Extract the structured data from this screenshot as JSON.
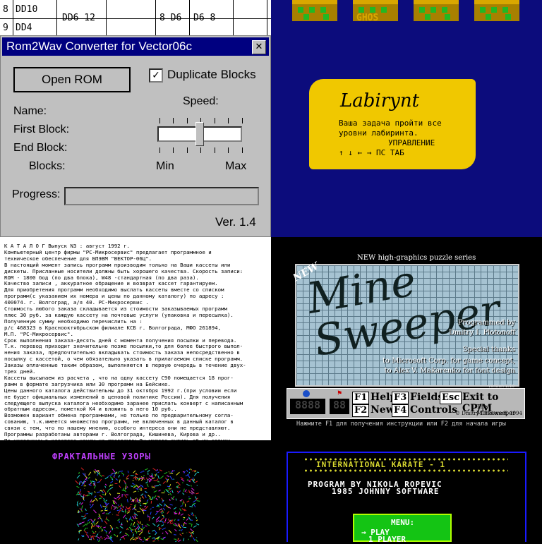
{
  "table": {
    "rows": [
      {
        "num": "8",
        "name": "DD10",
        "a": "DD6  12",
        "b": "8  D6",
        "c": "D6   8"
      },
      {
        "num": "9",
        "name": "DD4"
      }
    ]
  },
  "window": {
    "title": "Rom2Wav Converter for Vector06c",
    "close_glyph": "✕",
    "open_rom": "Open ROM",
    "duplicate_blocks": "Duplicate Blocks",
    "duplicate_checked": true,
    "check_glyph": "✓",
    "speed": "Speed:",
    "name": "Name:",
    "first_block": "First Block:",
    "end_block": "End Block:",
    "blocks": "Blocks:",
    "min": "Min",
    "max": "Max",
    "progress": "Progress:",
    "version": "Ver. 1.4"
  },
  "game": {
    "ghos": "GHOS",
    "scroll_title": "Labirynt",
    "scroll_lines": [
      "Ваша задача пройти все",
      "уровни лабиринта.",
      "УПРАВЛЕНИЕ",
      "↑  ↓  ←  →  ПС  ТАБ"
    ]
  },
  "catalog": {
    "lines": [
      "К А Т А Л О Г                                    Выпуск N3 : август 1992 г.",
      "     Компьютерный центр фирмы  \"PC-Микросервис\"  предлагает программное и",
      "техническое обеспечение для БПЭВМ \"ВЕКТОР-06Ц\".",
      "   В настоящий момент запись программ производим только на Ваши кассеты или",
      "дискеты. Присланные носители должны быть хорошего качества. Скорость записи:",
      " ROM - 1800 бод (по два блока), W48 -стандартная (по два раза).",
      "Качество   записи , аккуратное обращение  и возврат   кассет  гарантируем.",
      "   Для приобретения программ необходимо выслать  кассеты  вместе со списком",
      "программ(с указанием их номера и цены по данному каталогу) по адресу :",
      "      400074. г. Волгоград, а/я 40. PC-Микросервис .",
      "  Стоимость любого заказа складывается  из стоимости заказываемых  программ",
      "плюс  30 руб. за каждую кассету  на  почтовые услуги (упаковка и пересылка).",
      "Полученную сумму необходимо перечислить на :",
      "    р/с 468323 в Краснооктябрьском филиале КСБ г. Волгограда, МФО 261894,",
      "          М.П. \"PC-Микросервис\".",
      "   Срок выполнения заказа-десять дней с момента получения посылки и перевода.",
      "   Т.к. перевод приходит значительно позже посылки,то для более быстрого выпол-",
      "нения заказа, предпочтительно вкладывать стоимость заказа  непосредственно  в",
      "посылку с кассетой, о чем обязательно указать в прилагаемом списке программ.",
      "Заказы оплаченные таким образом, выполняются в первую очередь в течение двух-",
      "трех дней.",
      "   Кассеты  высылаем из расчета , что на одну кассету С90 помещается 18 прог-",
      "рамм в формате загрузчика или 30 программ на Бейсике.",
      "   Цены данного каталога действительны до 31 октября 1992 г.(при условии если",
      "не  будет официальных изменений  в  ценовой политике России). Для  получения",
      "следующего выпуска каталога необходимо заранее прислать конверт с написанным",
      "обратным адресом, пометкой К4 и вложить в него 10 руб..",
      "   Возможен вариант обмена программами, но только по предварительному согла-",
      "сованию, т.к.имеется множество программ, не включенных в данный каталог  в",
      "  связи с тем, что по нашему мнению, особого интереса они не представляют.",
      "   Программы разработаны авторами г. Волгограда, Кишинева, Кирова и др..",
      "   По указанным в каталоге ценам на программы  Вы можете судить об их совмен-"
    ]
  },
  "mine": {
    "header": "NEW high-graphics puzzle series",
    "badge": "NEW",
    "title1": "Mine",
    "title2": "Sweeper",
    "programmed": "Programmed by",
    "author": "Dmitry I. Plotonoff",
    "thanks": "Special thanks",
    "thanks1": "to Microsoft Corp. for game concept,",
    "thanks2": "to Alex V. Makarenko for font design",
    "version": "version 1.10",
    "lcd1": "8888",
    "lcd2": "88",
    "k_f1": "F1",
    "l_help": "Help",
    "k_f3": "F3",
    "l_fields": "Fields",
    "k_esc": "Esc",
    "l_exit": "Exit to CP/M",
    "k_f2": "F2",
    "l_new": "New",
    "k_f4": "F4",
    "l_controls": "Controls",
    "small_title": "The Minesweeper",
    "copyright": "© Dmitry I.Plotonoff, 1994",
    "footer": "Нажмите F1 для получения инструкции или F2 для начала игры"
  },
  "fractal": {
    "title": "ФРАКТАЛЬНЫЕ УЗОРЫ"
  },
  "karate": {
    "title": "INTERNATIONAL KARATE - 1",
    "line1": "PROGRAM BY NIKOLA ROPEVIC",
    "line2": "1985 JOHNNY SOFTWARE",
    "menu": "MENU:",
    "item1": "→ PLAY",
    "item2": "1 PLAYER"
  },
  "colors": {
    "win_title_bg": "#000080",
    "game_bg": "#0c0c7c",
    "scroll": "#f0c800",
    "fractal_title": "#c040ff",
    "menu_green": "#14c414"
  }
}
